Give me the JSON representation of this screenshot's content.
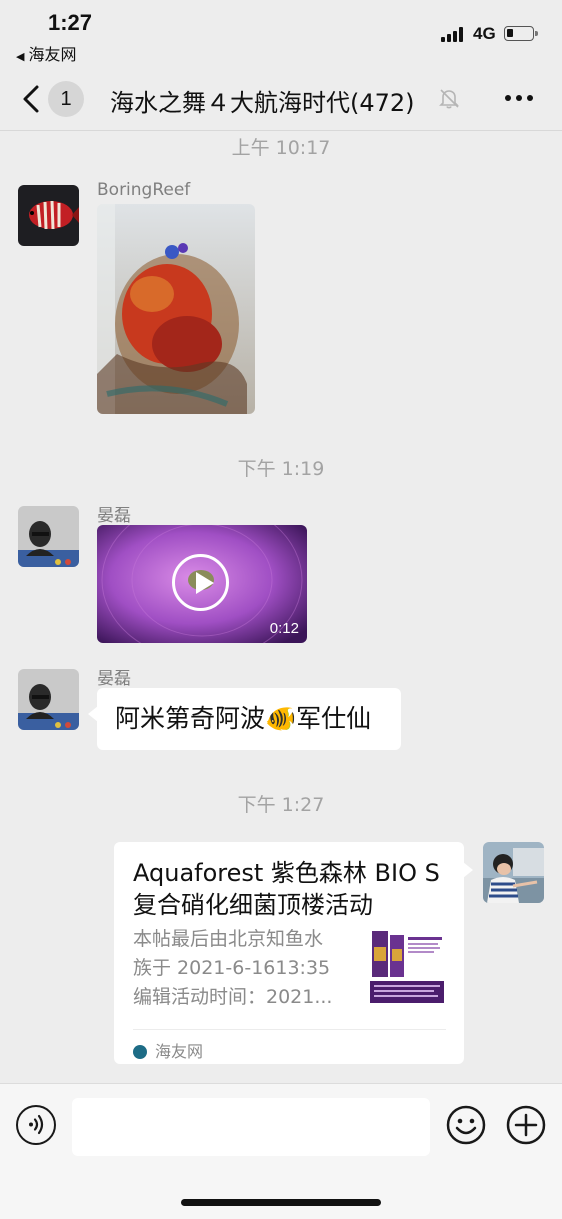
{
  "status": {
    "time": "1:27",
    "back_app": "海友网",
    "network": "4G",
    "battery_level": 0.25
  },
  "nav": {
    "unread_badge": "1",
    "title": "海水之舞４大航海时代(472)",
    "muted_icon": "bell-slash-icon",
    "more_icon": "more-icon"
  },
  "messages": {
    "ts1": "上午 10:17",
    "m1_sender": "BoringReef",
    "ts2": "下午 1:19",
    "m2_sender": "晏磊",
    "m2_video_duration": "0:12",
    "m3_sender": "晏磊",
    "m3_text": "阿米第奇阿波🐠军仕仙",
    "ts3": "下午 1:27",
    "card_title": "Aquaforest 紫色森林 BIO S 复合硝化细菌顶楼活动",
    "card_desc_1": "本帖最后由北京知鱼水",
    "card_desc_2": "族于 2021-6-1613:35",
    "card_desc_3": "编辑活动时间：2021...",
    "card_source": "海友网"
  },
  "input": {
    "placeholder": ""
  },
  "colors": {
    "background": "#ededed",
    "bubble": "#ffffff",
    "timestamp": "#a3a3a3"
  }
}
